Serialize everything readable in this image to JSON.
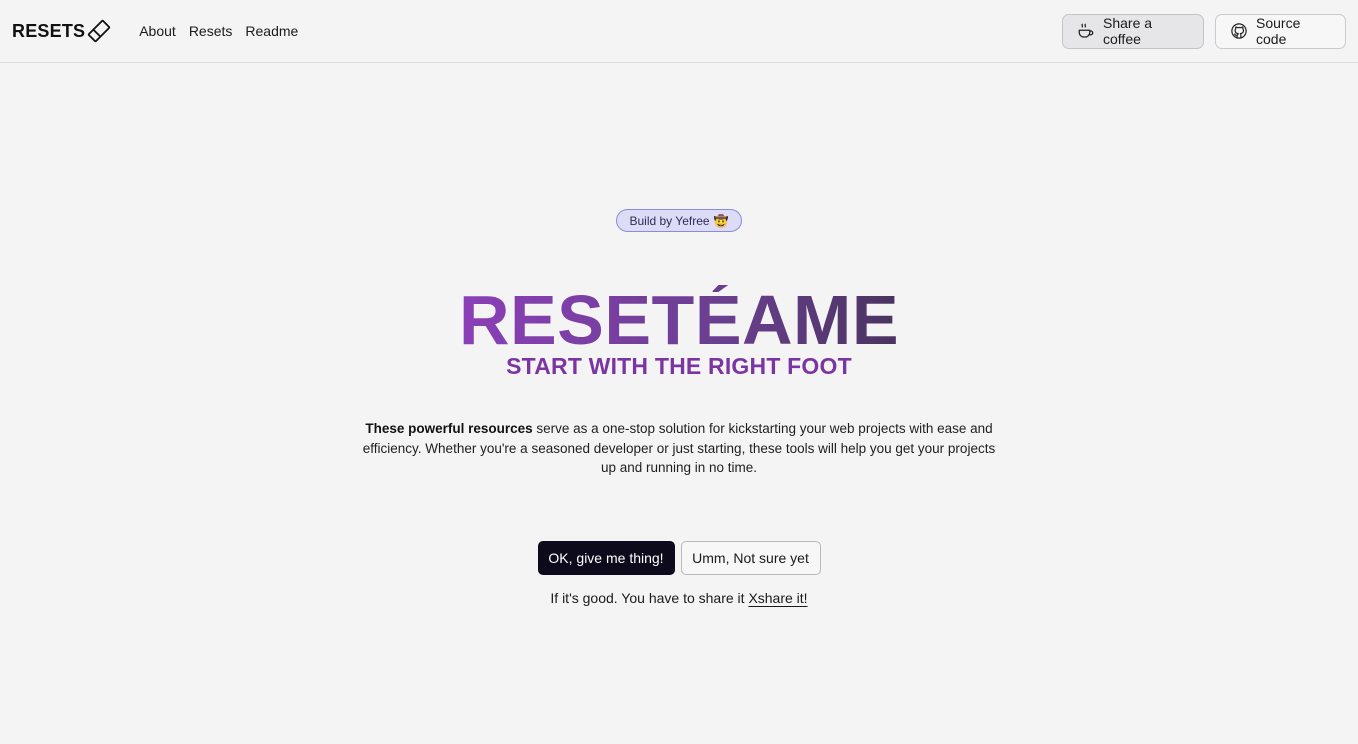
{
  "header": {
    "logo_text": "RESETS",
    "logo_icon": "eraser-icon",
    "nav": [
      {
        "label": "About"
      },
      {
        "label": "Resets"
      },
      {
        "label": "Readme"
      }
    ],
    "coffee_button": {
      "label": "Share a coffee",
      "icon": "coffee-cup-icon"
    },
    "source_button": {
      "label": "Source code",
      "icon": "github-icon"
    }
  },
  "hero": {
    "badge": {
      "text": "Build by Yefree",
      "emoji": "🤠"
    },
    "title": "RESETÉAME",
    "subtitle": "START WITH THE RIGHT FOOT",
    "description": {
      "bold": "These powerful resources",
      "rest": " serve as a one-stop solution for kickstarting your web projects with ease and efficiency. Whether you're a seasoned developer or just starting, these tools will help you get your projects up and running in no time."
    },
    "primary_cta": "OK, give me thing!",
    "secondary_cta": "Umm, Not sure yet",
    "share": {
      "prefix": "If it's good. You have to share it ",
      "link": "Xshare it!"
    }
  },
  "colors": {
    "background": "#f4f4f5",
    "title_gradient_start": "#8b3fb8",
    "title_gradient_end": "#4a3460",
    "subtitle": "#7a35a3",
    "primary_button": "#0d0a1c",
    "badge_bg": "#dcdcf6",
    "badge_border": "#8b8bd8"
  }
}
